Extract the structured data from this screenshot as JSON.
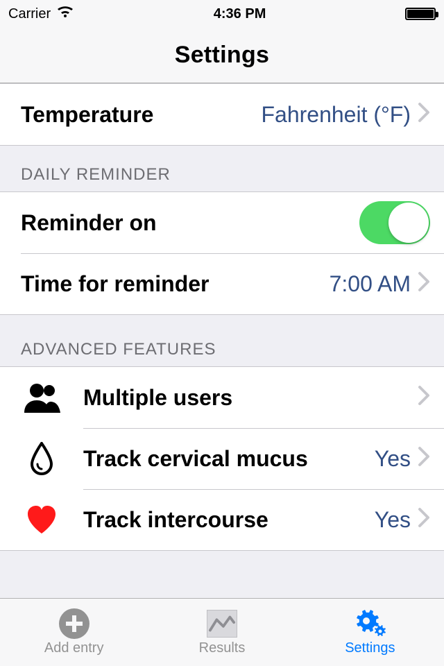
{
  "status": {
    "carrier": "Carrier",
    "time": "4:36 PM"
  },
  "nav": {
    "title": "Settings"
  },
  "section_temp": {
    "rows": [
      {
        "label": "Temperature",
        "value": "Fahrenheit (°F)"
      }
    ]
  },
  "section_reminder": {
    "header": "DAILY REMINDER",
    "rows": {
      "reminder_on": {
        "label": "Reminder on",
        "on": true
      },
      "time": {
        "label": "Time for reminder",
        "value": "7:00 AM"
      }
    }
  },
  "section_advanced": {
    "header": "ADVANCED FEATURES",
    "rows": {
      "users": {
        "label": "Multiple users"
      },
      "mucus": {
        "label": "Track cervical mucus",
        "value": "Yes"
      },
      "intercourse": {
        "label": "Track intercourse",
        "value": "Yes"
      }
    }
  },
  "tabs": {
    "add": {
      "label": "Add entry"
    },
    "results": {
      "label": "Results"
    },
    "settings": {
      "label": "Settings"
    }
  }
}
